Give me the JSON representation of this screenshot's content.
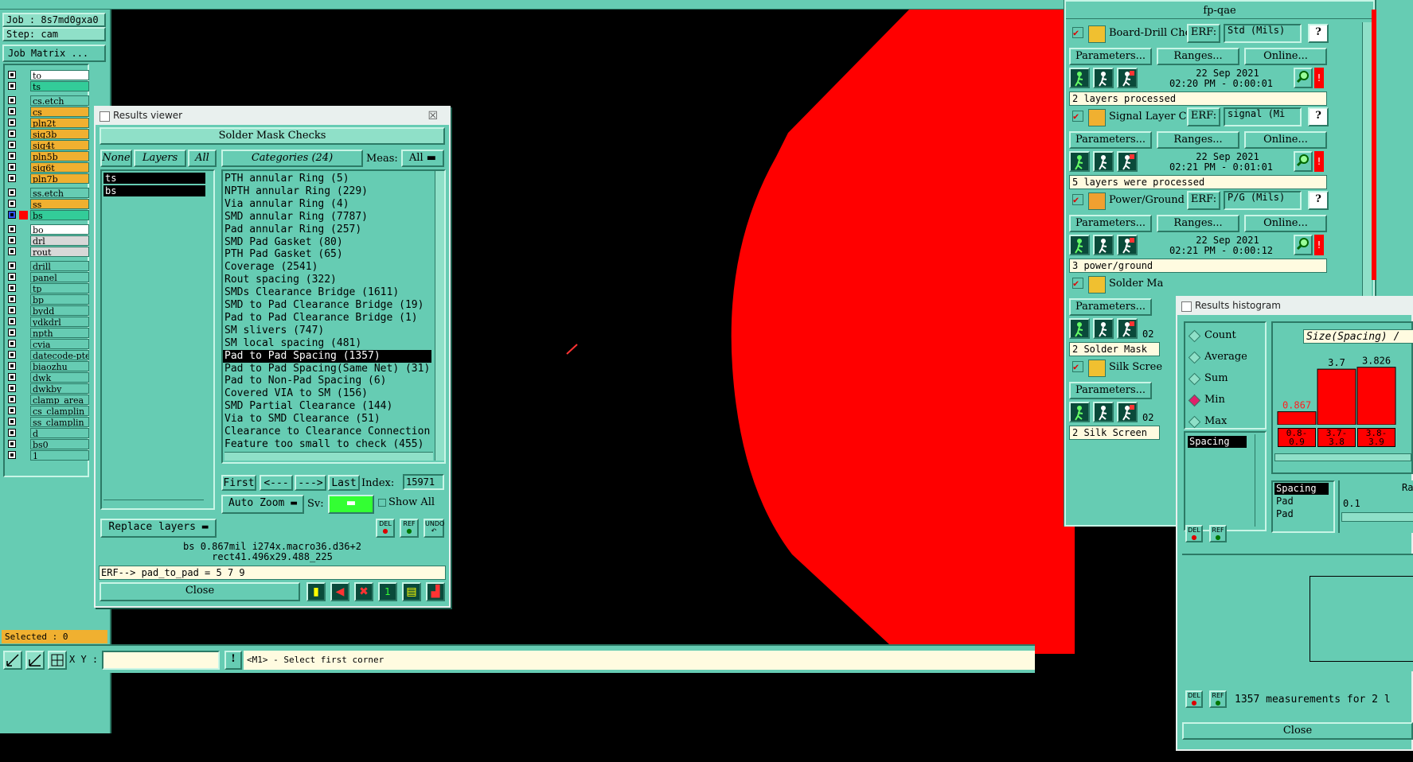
{
  "left_panel": {
    "job": "Job : 8s7md0gxa0",
    "step": "Step: cam",
    "job_matrix": "Job Matrix ...",
    "layers": [
      {
        "name": "to",
        "color": "#ffffff",
        "active": false
      },
      {
        "name": "ts",
        "color": "#33cc99",
        "active": false
      },
      {
        "name": "cs.etch",
        "color": "#66ccb3",
        "active": false
      },
      {
        "name": "cs",
        "color": "#f0b030",
        "active": false
      },
      {
        "name": "pln2t",
        "color": "#f0b030",
        "active": false
      },
      {
        "name": "sig3b",
        "color": "#f0b030",
        "active": false
      },
      {
        "name": "sig4t",
        "color": "#f0b030",
        "active": false
      },
      {
        "name": "pln5b",
        "color": "#f0b030",
        "active": false
      },
      {
        "name": "sig6t",
        "color": "#f0b030",
        "active": false
      },
      {
        "name": "pln7b",
        "color": "#f0b030",
        "active": false
      },
      {
        "name": "ss.etch",
        "color": "#66ccb3",
        "active": false
      },
      {
        "name": "ss",
        "color": "#f0b030",
        "active": false
      },
      {
        "name": "bs",
        "color": "#33cc99",
        "active": true
      },
      {
        "name": "bo",
        "color": "#ffffff",
        "active": false
      },
      {
        "name": "drl",
        "color": "#d8d8d8",
        "active": false
      },
      {
        "name": "rout",
        "color": "#d8d8d8",
        "active": false
      },
      {
        "name": "drill",
        "color": "#66ccb3",
        "active": false
      },
      {
        "name": "panel",
        "color": "#66ccb3",
        "active": false
      },
      {
        "name": "tp",
        "color": "#66ccb3",
        "active": false
      },
      {
        "name": "bp",
        "color": "#66ccb3",
        "active": false
      },
      {
        "name": "bydd",
        "color": "#66ccb3",
        "active": false
      },
      {
        "name": "ydkdrl",
        "color": "#66ccb3",
        "active": false
      },
      {
        "name": "npth",
        "color": "#66ccb3",
        "active": false
      },
      {
        "name": "cvia",
        "color": "#66ccb3",
        "active": false
      },
      {
        "name": "datecode-pte",
        "color": "#66ccb3",
        "active": false
      },
      {
        "name": "biaozhu",
        "color": "#66ccb3",
        "active": false
      },
      {
        "name": "dwk",
        "color": "#66ccb3",
        "active": false
      },
      {
        "name": "dwkby",
        "color": "#66ccb3",
        "active": false
      },
      {
        "name": "clamp_area",
        "color": "#66ccb3",
        "active": false
      },
      {
        "name": "cs_clamplin",
        "color": "#66ccb3",
        "active": false
      },
      {
        "name": "ss_clamplin",
        "color": "#66ccb3",
        "active": false
      },
      {
        "name": "d",
        "color": "#66ccb3",
        "active": false
      },
      {
        "name": "bs0",
        "color": "#66ccb3",
        "active": false
      },
      {
        "name": "1",
        "color": "#66ccb3",
        "active": false
      }
    ],
    "selected": "Selected : 0"
  },
  "status_bar": {
    "xy_label": "X Y :",
    "xy_value": "",
    "prompt": "<M1> - Select first corner"
  },
  "results_viewer": {
    "title": "Results viewer",
    "header": "Solder Mask Checks",
    "none_btn": "None",
    "layers_btn": "Layers",
    "all_btn": "All",
    "layers": [
      "ts",
      "bs"
    ],
    "categories_btn": "Categories (24)",
    "meas_label": "Meas:",
    "meas_value": "All",
    "categories": [
      "PTH annular Ring (5)",
      "NPTH annular Ring (229)",
      "Via annular Ring (4)",
      "SMD annular Ring (7787)",
      "Pad annular Ring (257)",
      "SMD Pad Gasket (80)",
      "PTH Pad Gasket (65)",
      "Coverage (2541)",
      "Rout spacing (322)",
      "SMDs Clearance Bridge (1611)",
      "SMD to Pad Clearance Bridge (19)",
      "Pad to Pad Clearance Bridge (1)",
      "SM slivers (747)",
      "SM local spacing (481)",
      "Pad to Pad Spacing (1357)",
      "Pad to Pad Spacing(Same Net) (31)",
      "Pad to Non-Pad Spacing (6)",
      "Covered VIA to SM (156)",
      "SMD Partial Clearance (144)",
      "Via to SMD Clearance (51)",
      "Clearance to Clearance Connection",
      "Feature too small to check (455)"
    ],
    "selected_category_index": 14,
    "first_btn": "First",
    "prev_btn": "<---",
    "next_btn": "--->",
    "last_btn": "Last",
    "index_label": "Index:",
    "index_value": "15971",
    "auto_zoom": "Auto Zoom",
    "sv_label": "Sv:",
    "show_all": "Show All",
    "replace_layers": "Replace layers",
    "info_line1": "bs 0.867mil  i274x.macro36.d36+2",
    "info_line2": "rect41.496x29.488_225",
    "erf_line": "ERF--> pad_to_pad = 5 7 9",
    "close": "Close",
    "del_label": "DEL",
    "ref_label": "REF",
    "undo_label": "UNDO"
  },
  "fp_qae": {
    "title": "fp-qae",
    "analyses": [
      {
        "name": "Board-Drill Che",
        "erf": "ERF:",
        "erf_value": "Std (Mils)",
        "date": "22 Sep 2021",
        "time": "02:20 PM - 0:00:01",
        "status": "2 layers processed"
      },
      {
        "name": "Signal Layer Ch",
        "erf": "ERF:",
        "erf_value": "signal (Mi",
        "date": "22 Sep 2021",
        "time": "02:21 PM - 0:01:01",
        "status": "5 layers were processed"
      },
      {
        "name": "Power/Ground C",
        "erf": "ERF:",
        "erf_value": "P/G (Mils)",
        "date": "22 Sep 2021",
        "time": "02:21 PM - 0:00:12",
        "status": "3 power/ground"
      },
      {
        "name": "Solder Ma",
        "erf": "",
        "erf_value": "",
        "date": "",
        "time": "02",
        "status": "2 Solder Mask"
      },
      {
        "name": "Silk Scree",
        "erf": "",
        "erf_value": "",
        "date": "",
        "time": "02",
        "status": "2 Silk Screen"
      }
    ],
    "parameters_btn": "Parameters...",
    "ranges_btn": "Ranges...",
    "online_btn": "Online...",
    "help_glyph": "?"
  },
  "histogram": {
    "title": "Results histogram",
    "options": [
      "Count",
      "Average",
      "Sum",
      "Min",
      "Max"
    ],
    "selected_option": "Min",
    "list_item": "Spacing",
    "chart_title": "Size(Spacing) /",
    "bars": [
      {
        "label": "0.8-\n0.9",
        "value": 0.867,
        "value_text": "0.867"
      },
      {
        "label": "3.7-\n3.8",
        "value": 3.7,
        "value_text": "3.7"
      },
      {
        "label": "3.8-\n3.9",
        "value": 3.826,
        "value_text": "3.826"
      }
    ],
    "table_rows": [
      "Spacing",
      "Pad",
      "Pad"
    ],
    "table_value": "0.1",
    "table_header": "Ra",
    "footer_text": "1357 measurements for 2 l",
    "close": "Close"
  }
}
